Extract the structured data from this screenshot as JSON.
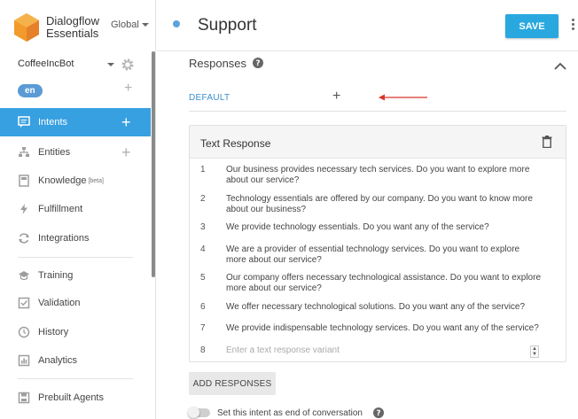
{
  "brand": {
    "line1": "Dialogflow",
    "line2": "Essentials",
    "region": "Global"
  },
  "agent": {
    "name": "CoffeeIncBot",
    "language": "en"
  },
  "nav": {
    "intents": "Intents",
    "entities": "Entities",
    "knowledge": "Knowledge",
    "knowledge_badge": "[beta]",
    "fulfillment": "Fulfillment",
    "integrations": "Integrations",
    "training": "Training",
    "validation": "Validation",
    "history": "History",
    "analytics": "Analytics",
    "prebuilt": "Prebuilt Agents"
  },
  "header": {
    "title": "Support",
    "save_label": "SAVE"
  },
  "responses": {
    "section_title": "Responses",
    "tab_default": "DEFAULT",
    "tab_add": "+",
    "card_title": "Text Response",
    "rows": [
      {
        "num": "1",
        "text": "Our business provides necessary tech services. Do you want to explore more about our service?"
      },
      {
        "num": "2",
        "text": "Technology essentials are offered by our company. Do you want to know more about our business?"
      },
      {
        "num": "3",
        "text": "We provide technology essentials. Do you want any of the service?"
      },
      {
        "num": "4",
        "text": "We are a provider of essential technology services.  Do you want to explore more about our service?"
      },
      {
        "num": "5",
        "text": "Our company offers necessary technological assistance.  Do you want to explore more about our service?"
      },
      {
        "num": "6",
        "text": "We offer necessary technological solutions. Do you want any of the service?"
      },
      {
        "num": "7",
        "text": "We provide indispensable technology services. Do you want any of the service?"
      }
    ],
    "new_row_num": "8",
    "new_row_placeholder": "Enter a text response variant",
    "add_button": "ADD RESPONSES",
    "end_conversation_label": "Set this intent as end of conversation"
  },
  "colors": {
    "accent": "#29a8e0",
    "active_nav": "#37a0e0",
    "arrow": "#d9342b"
  }
}
